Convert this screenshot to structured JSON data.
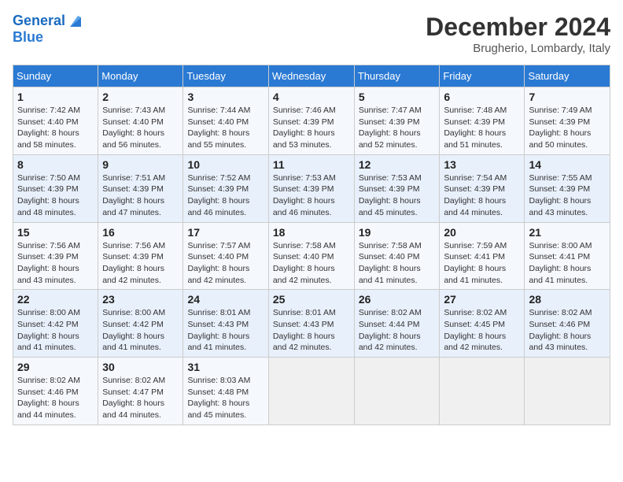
{
  "logo": {
    "line1": "General",
    "line2": "Blue"
  },
  "title": "December 2024",
  "subtitle": "Brugherio, Lombardy, Italy",
  "weekdays": [
    "Sunday",
    "Monday",
    "Tuesday",
    "Wednesday",
    "Thursday",
    "Friday",
    "Saturday"
  ],
  "weeks": [
    [
      {
        "day": "1",
        "sunrise": "Sunrise: 7:42 AM",
        "sunset": "Sunset: 4:40 PM",
        "daylight": "Daylight: 8 hours and 58 minutes."
      },
      {
        "day": "2",
        "sunrise": "Sunrise: 7:43 AM",
        "sunset": "Sunset: 4:40 PM",
        "daylight": "Daylight: 8 hours and 56 minutes."
      },
      {
        "day": "3",
        "sunrise": "Sunrise: 7:44 AM",
        "sunset": "Sunset: 4:40 PM",
        "daylight": "Daylight: 8 hours and 55 minutes."
      },
      {
        "day": "4",
        "sunrise": "Sunrise: 7:46 AM",
        "sunset": "Sunset: 4:39 PM",
        "daylight": "Daylight: 8 hours and 53 minutes."
      },
      {
        "day": "5",
        "sunrise": "Sunrise: 7:47 AM",
        "sunset": "Sunset: 4:39 PM",
        "daylight": "Daylight: 8 hours and 52 minutes."
      },
      {
        "day": "6",
        "sunrise": "Sunrise: 7:48 AM",
        "sunset": "Sunset: 4:39 PM",
        "daylight": "Daylight: 8 hours and 51 minutes."
      },
      {
        "day": "7",
        "sunrise": "Sunrise: 7:49 AM",
        "sunset": "Sunset: 4:39 PM",
        "daylight": "Daylight: 8 hours and 50 minutes."
      }
    ],
    [
      {
        "day": "8",
        "sunrise": "Sunrise: 7:50 AM",
        "sunset": "Sunset: 4:39 PM",
        "daylight": "Daylight: 8 hours and 48 minutes."
      },
      {
        "day": "9",
        "sunrise": "Sunrise: 7:51 AM",
        "sunset": "Sunset: 4:39 PM",
        "daylight": "Daylight: 8 hours and 47 minutes."
      },
      {
        "day": "10",
        "sunrise": "Sunrise: 7:52 AM",
        "sunset": "Sunset: 4:39 PM",
        "daylight": "Daylight: 8 hours and 46 minutes."
      },
      {
        "day": "11",
        "sunrise": "Sunrise: 7:53 AM",
        "sunset": "Sunset: 4:39 PM",
        "daylight": "Daylight: 8 hours and 46 minutes."
      },
      {
        "day": "12",
        "sunrise": "Sunrise: 7:53 AM",
        "sunset": "Sunset: 4:39 PM",
        "daylight": "Daylight: 8 hours and 45 minutes."
      },
      {
        "day": "13",
        "sunrise": "Sunrise: 7:54 AM",
        "sunset": "Sunset: 4:39 PM",
        "daylight": "Daylight: 8 hours and 44 minutes."
      },
      {
        "day": "14",
        "sunrise": "Sunrise: 7:55 AM",
        "sunset": "Sunset: 4:39 PM",
        "daylight": "Daylight: 8 hours and 43 minutes."
      }
    ],
    [
      {
        "day": "15",
        "sunrise": "Sunrise: 7:56 AM",
        "sunset": "Sunset: 4:39 PM",
        "daylight": "Daylight: 8 hours and 43 minutes."
      },
      {
        "day": "16",
        "sunrise": "Sunrise: 7:56 AM",
        "sunset": "Sunset: 4:39 PM",
        "daylight": "Daylight: 8 hours and 42 minutes."
      },
      {
        "day": "17",
        "sunrise": "Sunrise: 7:57 AM",
        "sunset": "Sunset: 4:40 PM",
        "daylight": "Daylight: 8 hours and 42 minutes."
      },
      {
        "day": "18",
        "sunrise": "Sunrise: 7:58 AM",
        "sunset": "Sunset: 4:40 PM",
        "daylight": "Daylight: 8 hours and 42 minutes."
      },
      {
        "day": "19",
        "sunrise": "Sunrise: 7:58 AM",
        "sunset": "Sunset: 4:40 PM",
        "daylight": "Daylight: 8 hours and 41 minutes."
      },
      {
        "day": "20",
        "sunrise": "Sunrise: 7:59 AM",
        "sunset": "Sunset: 4:41 PM",
        "daylight": "Daylight: 8 hours and 41 minutes."
      },
      {
        "day": "21",
        "sunrise": "Sunrise: 8:00 AM",
        "sunset": "Sunset: 4:41 PM",
        "daylight": "Daylight: 8 hours and 41 minutes."
      }
    ],
    [
      {
        "day": "22",
        "sunrise": "Sunrise: 8:00 AM",
        "sunset": "Sunset: 4:42 PM",
        "daylight": "Daylight: 8 hours and 41 minutes."
      },
      {
        "day": "23",
        "sunrise": "Sunrise: 8:00 AM",
        "sunset": "Sunset: 4:42 PM",
        "daylight": "Daylight: 8 hours and 41 minutes."
      },
      {
        "day": "24",
        "sunrise": "Sunrise: 8:01 AM",
        "sunset": "Sunset: 4:43 PM",
        "daylight": "Daylight: 8 hours and 41 minutes."
      },
      {
        "day": "25",
        "sunrise": "Sunrise: 8:01 AM",
        "sunset": "Sunset: 4:43 PM",
        "daylight": "Daylight: 8 hours and 42 minutes."
      },
      {
        "day": "26",
        "sunrise": "Sunrise: 8:02 AM",
        "sunset": "Sunset: 4:44 PM",
        "daylight": "Daylight: 8 hours and 42 minutes."
      },
      {
        "day": "27",
        "sunrise": "Sunrise: 8:02 AM",
        "sunset": "Sunset: 4:45 PM",
        "daylight": "Daylight: 8 hours and 42 minutes."
      },
      {
        "day": "28",
        "sunrise": "Sunrise: 8:02 AM",
        "sunset": "Sunset: 4:46 PM",
        "daylight": "Daylight: 8 hours and 43 minutes."
      }
    ],
    [
      {
        "day": "29",
        "sunrise": "Sunrise: 8:02 AM",
        "sunset": "Sunset: 4:46 PM",
        "daylight": "Daylight: 8 hours and 44 minutes."
      },
      {
        "day": "30",
        "sunrise": "Sunrise: 8:02 AM",
        "sunset": "Sunset: 4:47 PM",
        "daylight": "Daylight: 8 hours and 44 minutes."
      },
      {
        "day": "31",
        "sunrise": "Sunrise: 8:03 AM",
        "sunset": "Sunset: 4:48 PM",
        "daylight": "Daylight: 8 hours and 45 minutes."
      },
      null,
      null,
      null,
      null
    ]
  ]
}
